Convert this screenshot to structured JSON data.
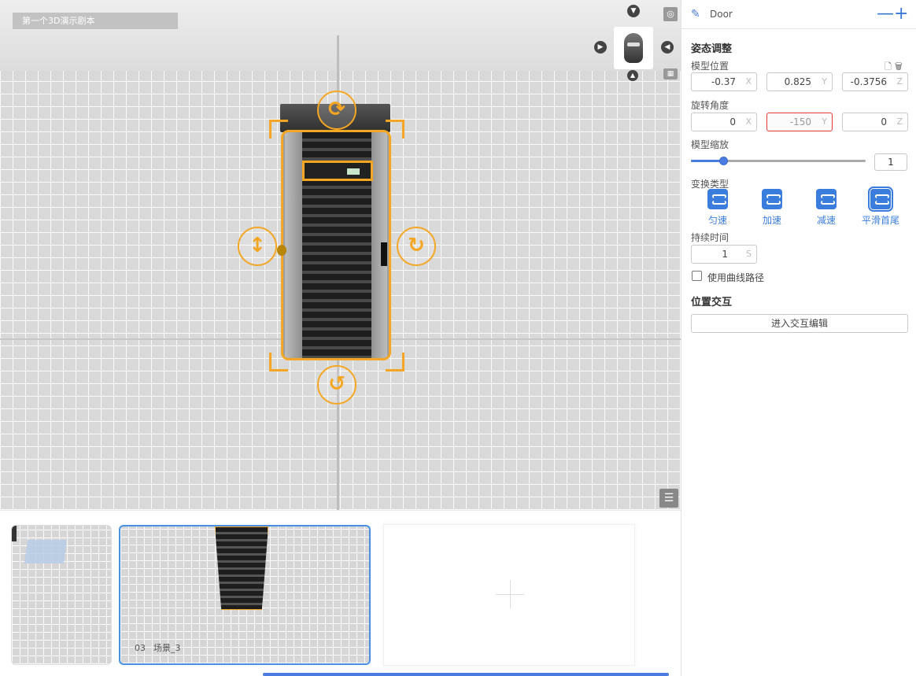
{
  "viewport": {
    "scene_title": "第一个3D演示剧本",
    "object_name": "Door"
  },
  "filmstrip": {
    "thumbnails": [
      {
        "index": "",
        "name": "",
        "selected": false
      },
      {
        "index": "03",
        "name": "场景_3",
        "selected": true
      }
    ],
    "add_label": "+"
  },
  "panel": {
    "header": {
      "object_name": "Door",
      "minus": "—",
      "plus": "+"
    },
    "pose": {
      "title": "姿态调整",
      "position_label": "模型位置",
      "position": {
        "x": "-0.37",
        "y": "0.825",
        "z": "-0.3756"
      },
      "rotation_label": "旋转角度",
      "rotation": {
        "x": "0",
        "y": "-150",
        "z": "0"
      },
      "scale_label": "模型缩放",
      "scale_value": "1",
      "scale_fraction": 0.19,
      "axis_x": "X",
      "axis_y": "Y",
      "axis_z": "Z"
    },
    "transition": {
      "label": "变换类型",
      "types": [
        {
          "label": "匀速",
          "active": false
        },
        {
          "label": "加速",
          "active": false
        },
        {
          "label": "减速",
          "active": false
        },
        {
          "label": "平滑首尾",
          "active": true
        }
      ],
      "duration_label": "持续时间",
      "duration_value": "1",
      "duration_unit": "S",
      "curve_checkbox_label": "使用曲线路径",
      "curve_checked": false
    },
    "interaction": {
      "title": "位置交互",
      "button_label": "进入交互编辑"
    }
  },
  "colors": {
    "accent": "#3b7ddd",
    "selection": "#f5a623",
    "error": "#e53935"
  }
}
